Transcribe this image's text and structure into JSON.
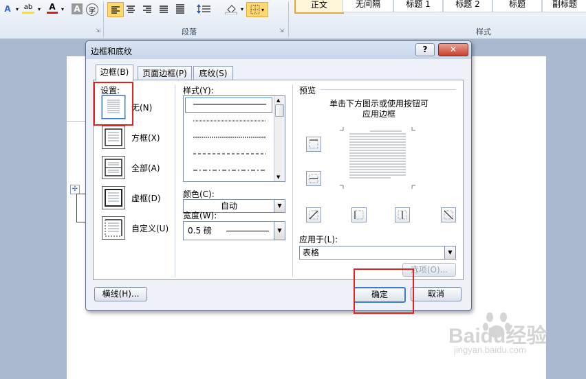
{
  "ribbon": {
    "groups": {
      "paragraph": "段落",
      "styles": "样式"
    },
    "styles": [
      "正文",
      "无间隔",
      "标题 1",
      "标题 2",
      "标题",
      "副标题"
    ],
    "icons": [
      "text-effect-icon",
      "highlight-icon",
      "font-color-icon",
      "char-shading-icon",
      "enclose-char-icon",
      "align-left-icon",
      "align-center-icon",
      "align-right-icon",
      "justify-icon",
      "distributed-icon",
      "line-spacing-icon",
      "shading-icon",
      "borders-icon"
    ]
  },
  "dialog": {
    "title": "边框和底纹",
    "help_label": "?",
    "close_label": "✕",
    "tabs": [
      "边框(B)",
      "页面边框(P)",
      "底纹(S)"
    ],
    "settings_label": "设置:",
    "settings": [
      "无(N)",
      "方框(X)",
      "全部(A)",
      "虚框(D)",
      "自定义(U)"
    ],
    "style_label": "样式(Y):",
    "color_label": "颜色(C):",
    "color_value": "自动",
    "width_label": "宽度(W):",
    "width_value": "0.5 磅",
    "preview_label": "预览",
    "preview_hint_1": "单击下方图示或使用按钮可",
    "preview_hint_2": "应用边框",
    "apply_to_label": "应用于(L):",
    "apply_to_value": "表格",
    "options_button": "选项(O)...",
    "horizontal_line_button": "横线(H)...",
    "ok_button": "确定",
    "cancel_button": "取消"
  },
  "watermark": {
    "logo": "Baidu经验",
    "url": "jingyan.baidu.com"
  },
  "colors": {
    "highlight_red": "#e52222",
    "dialog_bg": "#eef2f8",
    "title_bar": "#c5d5ea"
  }
}
